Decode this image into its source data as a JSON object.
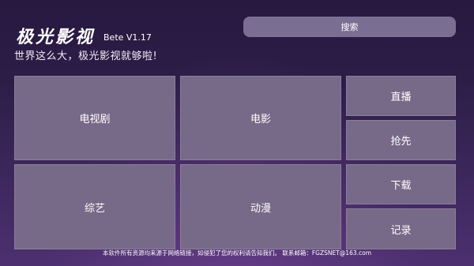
{
  "header": {
    "logo_text": "极光影视",
    "version": "Bete V1.17",
    "slogan": "世界这么大，极光影视就够啦!"
  },
  "search": {
    "label": "搜索"
  },
  "tiles": {
    "tv_series": "电视剧",
    "movie": "电影",
    "variety": "综艺",
    "anime": "动漫",
    "live": "直播",
    "preview": "抢先",
    "download": "下载",
    "history": "记录"
  },
  "footer": {
    "notice": "本软件所有资源均来源于网络链接，如侵犯了您的权利请告知我们。 联系邮箱：FGZSNET@163.com"
  },
  "colors": {
    "background_top": "#27193f",
    "background_bottom": "#4c3070",
    "tile": "#776988",
    "search_bar": "#7a6e92"
  }
}
